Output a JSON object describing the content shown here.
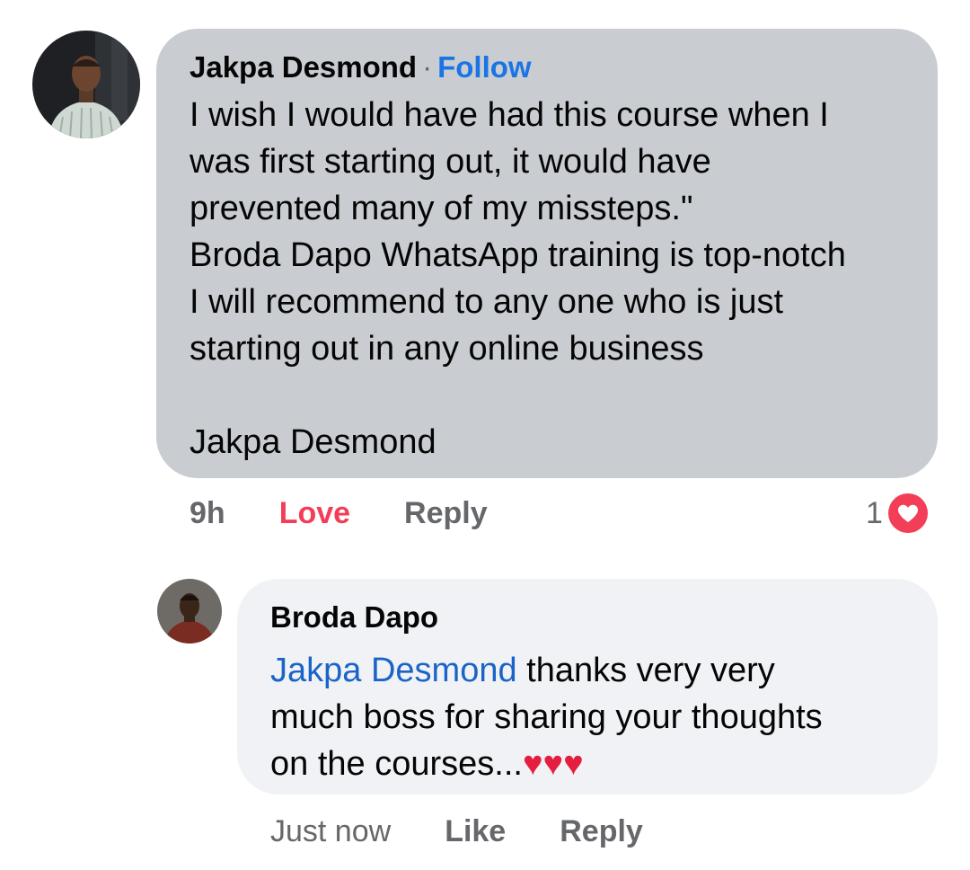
{
  "comment": {
    "author": "Jakpa Desmond",
    "separator": "·",
    "follow_label": "Follow",
    "text": "I wish I would have had this course when I\nwas first starting out, it would have\nprevented many of my missteps.\"\nBroda Dapo WhatsApp training is top-notch\nI will recommend to any one who is just\nstarting out in any online business\n\nJakpa Desmond",
    "time": "9h",
    "love_label": "Love",
    "reply_label": "Reply",
    "reaction_count": "1",
    "reaction_icon": "heart-icon"
  },
  "reply": {
    "author": "Broda Dapo",
    "mention": "Jakpa Desmond",
    "text": " thanks very very\nmuch boss for sharing your thoughts\non the courses...",
    "hearts": "♥♥♥",
    "time": "Just now",
    "like_label": "Like",
    "reply_label": "Reply"
  },
  "colors": {
    "bubble_main": "#c9ccd1",
    "bubble_reply": "#f0f2f5",
    "link_blue": "#1b74e4",
    "love_red": "#f33e58"
  }
}
